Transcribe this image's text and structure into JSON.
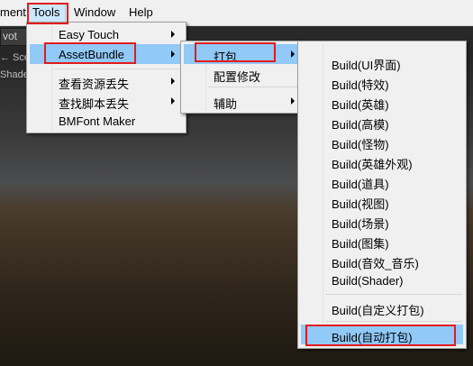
{
  "menubar": {
    "items": [
      "ment",
      "Tools",
      "Window",
      "Help"
    ]
  },
  "scene": {
    "toolbar_label": "vot",
    "labels": [
      "← Sce",
      "Shade"
    ]
  },
  "tools_menu": {
    "items": [
      {
        "label": "Easy Touch",
        "submenu": true
      },
      {
        "label": "AssetBundle",
        "submenu": true
      },
      {
        "label": "查看资源丢失",
        "submenu": true
      },
      {
        "label": "查找脚本丢失",
        "submenu": true
      },
      {
        "label": "BMFont Maker",
        "submenu": false
      }
    ]
  },
  "assetbundle_menu": {
    "items": [
      {
        "label": "打包",
        "submenu": true
      },
      {
        "label": "配置修改",
        "submenu": false
      },
      {
        "label": "辅助",
        "submenu": true
      }
    ]
  },
  "pack_menu": {
    "items": [
      "Build(UI界面)",
      "Build(特效)",
      "Build(英雄)",
      "Build(高模)",
      "Build(怪物)",
      "Build(英雄外观)",
      "Build(道具)",
      "Build(视图)",
      "Build(场景)",
      "Build(图集)",
      "Build(音效_音乐)",
      "Build(Shader)",
      "Build(自定义打包)",
      "Build(自动打包)"
    ]
  },
  "colors": {
    "menu_bg": "#f0f0f0",
    "highlight": "#91c9f7",
    "annotation_red": "#e21b1b"
  }
}
